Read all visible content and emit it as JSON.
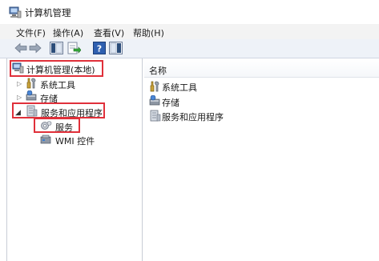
{
  "window": {
    "title": "计算机管理"
  },
  "menu": [
    {
      "label": "文件(F)"
    },
    {
      "label": "操作(A)"
    },
    {
      "label": "查看(V)"
    },
    {
      "label": "帮助(H)"
    }
  ],
  "toolbar": {
    "buttons": [
      "back-icon",
      "forward-icon",
      "show-hide-console-tree-icon",
      "export-list-icon",
      "help-icon",
      "properties-icon"
    ]
  },
  "tree": {
    "root": {
      "label": "计算机管理(本地)"
    },
    "items": [
      {
        "label": "系统工具"
      },
      {
        "label": "存储"
      },
      {
        "label": "服务和应用程序"
      },
      {
        "label": "服务"
      },
      {
        "label": "WMI 控件"
      }
    ]
  },
  "list": {
    "header": "名称",
    "rows": [
      {
        "label": "系统工具"
      },
      {
        "label": "存储"
      },
      {
        "label": "服务和应用程序"
      }
    ]
  },
  "colors": {
    "highlight": "#e0303a",
    "toolbar": "#eef2f8"
  }
}
